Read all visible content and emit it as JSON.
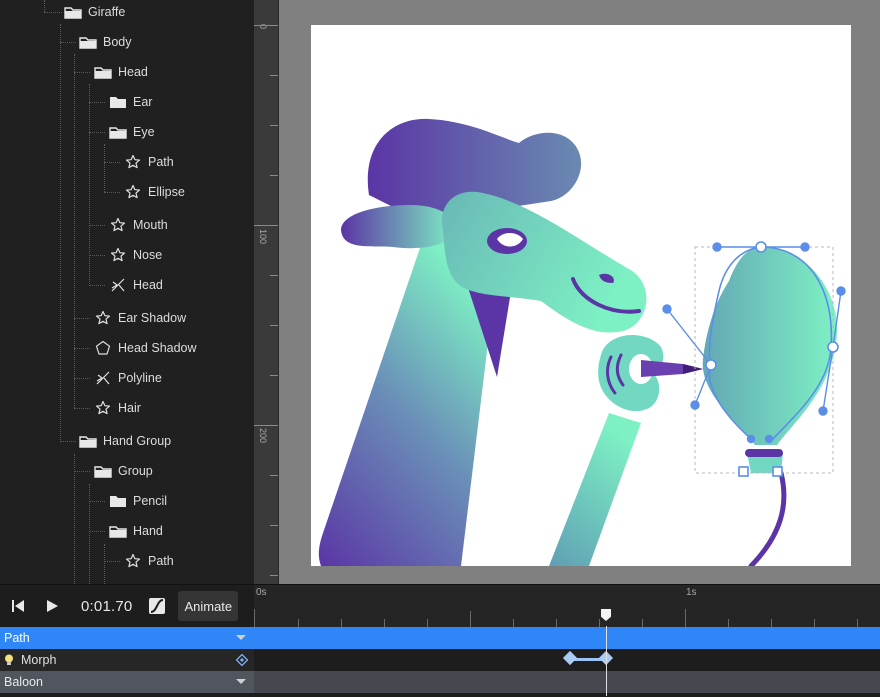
{
  "tree": {
    "items": [
      {
        "label": "Giraffe",
        "icon": "folder-icon"
      },
      {
        "label": "Body",
        "icon": "folder-icon"
      },
      {
        "label": "Head",
        "icon": "folder-icon"
      },
      {
        "label": "Ear",
        "icon": "folder-icon"
      },
      {
        "label": "Eye",
        "icon": "folder-icon"
      },
      {
        "label": "Path",
        "icon": "star-path-icon"
      },
      {
        "label": "Ellipse",
        "icon": "star-path-icon"
      },
      {
        "label": "Mouth",
        "icon": "star-path-icon"
      },
      {
        "label": "Nose",
        "icon": "star-path-icon"
      },
      {
        "label": "Head",
        "icon": "crossed-path-icon"
      },
      {
        "label": "Ear Shadow",
        "icon": "star-path-icon"
      },
      {
        "label": "Head Shadow",
        "icon": "pentagon-icon"
      },
      {
        "label": "Polyline",
        "icon": "crossed-path-icon"
      },
      {
        "label": "Hair",
        "icon": "star-path-icon"
      },
      {
        "label": "Hand Group",
        "icon": "folder-icon"
      },
      {
        "label": "Group",
        "icon": "folder-icon"
      },
      {
        "label": "Pencil",
        "icon": "folder-icon"
      },
      {
        "label": "Hand",
        "icon": "folder-icon"
      },
      {
        "label": "Path",
        "icon": "star-path-icon"
      }
    ]
  },
  "ruler": {
    "labels": [
      "0",
      "100",
      "200"
    ]
  },
  "colors": {
    "accent_blue": "#2f86f6",
    "gradient_purple": "#5b35a5",
    "gradient_mint": "#7ef1c4",
    "handle_blue": "#5b8ee8"
  },
  "timeline": {
    "time": "0:01.70",
    "animate_label": "Animate",
    "ruler_labels": [
      "0s",
      "1s"
    ],
    "tracks": [
      {
        "name": "Path",
        "selected": true
      },
      {
        "name": "Morph",
        "selected": false
      },
      {
        "name": "Baloon",
        "selected": false
      }
    ]
  }
}
